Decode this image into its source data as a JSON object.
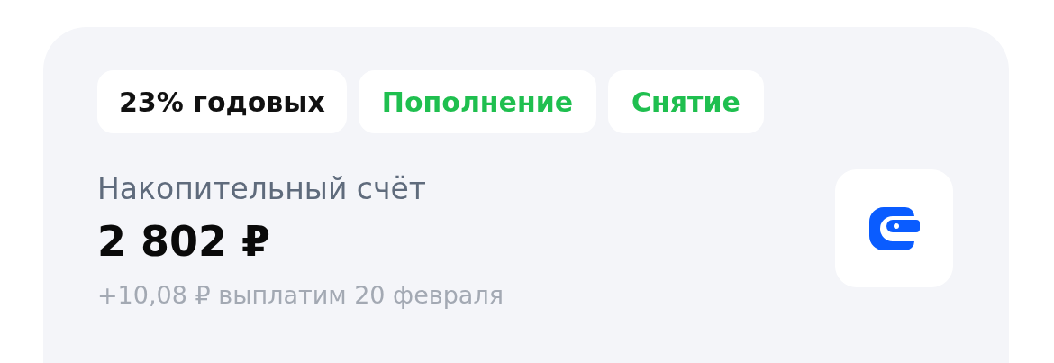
{
  "chips": [
    {
      "label": "23% годовых",
      "kind": "info"
    },
    {
      "label": "Пополнение",
      "kind": "action"
    },
    {
      "label": "Снятие",
      "kind": "action"
    }
  ],
  "account": {
    "title": "Накопительный счёт",
    "amount": "2 802 ₽",
    "payout": "+10,08 ₽ выплатим 20 февраля"
  }
}
